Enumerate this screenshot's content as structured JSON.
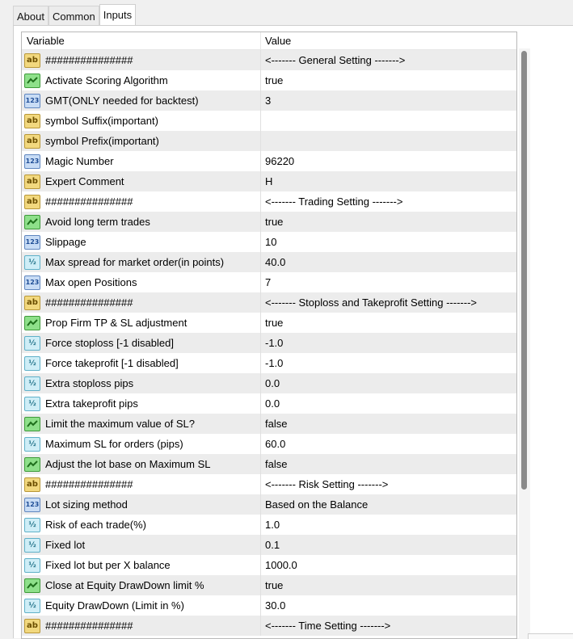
{
  "tabs": [
    {
      "label": "About",
      "active": false
    },
    {
      "label": "Common",
      "active": false
    },
    {
      "label": "Inputs",
      "active": true
    }
  ],
  "columns": {
    "variable": "Variable",
    "value": "Value"
  },
  "rows": [
    {
      "icon": "ab",
      "variable": "###############",
      "value": "<------- General Setting ------->"
    },
    {
      "icon": "bool",
      "variable": "Activate Scoring Algorithm",
      "value": "true"
    },
    {
      "icon": "int",
      "variable": "GMT(ONLY needed for backtest)",
      "value": "3"
    },
    {
      "icon": "ab",
      "variable": "symbol Suffix(important)",
      "value": ""
    },
    {
      "icon": "ab",
      "variable": "symbol Prefix(important)",
      "value": ""
    },
    {
      "icon": "int",
      "variable": "Magic Number",
      "value": "96220"
    },
    {
      "icon": "ab",
      "variable": "Expert Comment",
      "value": "H"
    },
    {
      "icon": "ab",
      "variable": "###############",
      "value": "<------- Trading Setting ------->"
    },
    {
      "icon": "bool",
      "variable": "Avoid long term trades",
      "value": "true"
    },
    {
      "icon": "int",
      "variable": "Slippage",
      "value": "10"
    },
    {
      "icon": "dbl",
      "variable": "Max spread for market order(in points)",
      "value": "40.0"
    },
    {
      "icon": "int",
      "variable": "Max open Positions",
      "value": "7"
    },
    {
      "icon": "ab",
      "variable": "###############",
      "value": "<------- Stoploss and Takeprofit Setting ------->"
    },
    {
      "icon": "bool",
      "variable": "Prop Firm TP & SL adjustment",
      "value": "true"
    },
    {
      "icon": "dbl",
      "variable": "Force stoploss [-1 disabled]",
      "value": "-1.0"
    },
    {
      "icon": "dbl",
      "variable": "Force takeprofit [-1 disabled]",
      "value": "-1.0"
    },
    {
      "icon": "dbl",
      "variable": "Extra stoploss pips",
      "value": "0.0"
    },
    {
      "icon": "dbl",
      "variable": "Extra takeprofit pips",
      "value": "0.0"
    },
    {
      "icon": "bool",
      "variable": "Limit the maximum value of SL?",
      "value": "false"
    },
    {
      "icon": "dbl",
      "variable": "Maximum SL for orders (pips)",
      "value": "60.0"
    },
    {
      "icon": "bool",
      "variable": "Adjust the lot base on Maximum SL",
      "value": "false"
    },
    {
      "icon": "ab",
      "variable": "###############",
      "value": "<------- Risk Setting ------->"
    },
    {
      "icon": "int",
      "variable": "Lot sizing method",
      "value": "Based on the Balance"
    },
    {
      "icon": "dbl",
      "variable": "Risk of each trade(%)",
      "value": "1.0"
    },
    {
      "icon": "dbl",
      "variable": "Fixed lot",
      "value": "0.1"
    },
    {
      "icon": "dbl",
      "variable": "Fixed lot but per X balance",
      "value": "1000.0"
    },
    {
      "icon": "bool",
      "variable": "Close at Equity DrawDown limit %",
      "value": "true"
    },
    {
      "icon": "dbl",
      "variable": "Equity DrawDown (Limit in %)",
      "value": "30.0"
    },
    {
      "icon": "ab",
      "variable": "###############",
      "value": "<------- Time Setting ------->"
    }
  ],
  "icon_glyphs": {
    "ab": "ab",
    "int": "123",
    "dbl": "½"
  },
  "colors": {
    "row_alt": "#ececec",
    "row_white": "#ffffff",
    "bool_icon": "#8ee08a",
    "string_icon": "#f2d87e",
    "int_icon": "#c8dcf5",
    "double_icon": "#cfeef7",
    "scrollbar_thumb": "#8a8a8a"
  }
}
